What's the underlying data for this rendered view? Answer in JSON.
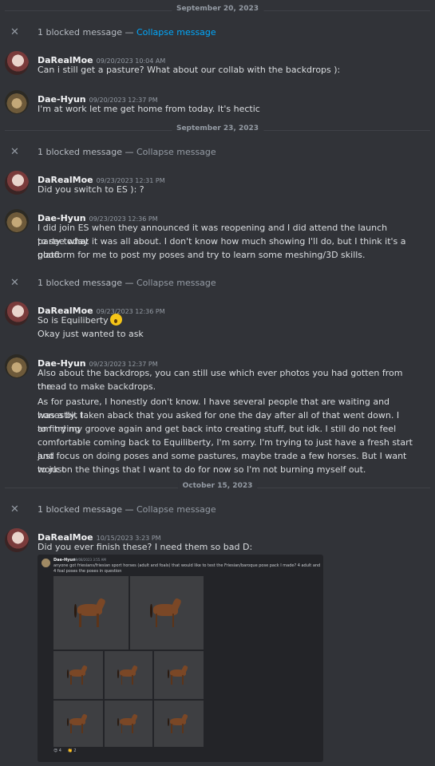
{
  "dividers": [
    "September 20, 2023",
    "September 23, 2023",
    "October 15, 2023"
  ],
  "blocked": {
    "icon": "close-icon",
    "text": "1 blocked message",
    "dash": " — ",
    "link": "Collapse message"
  },
  "messages": [
    {
      "author": "DaRealMoe",
      "time": "09/20/2023 10:04 AM",
      "lines": [
        "Can i still get a pasture? What about our collab with the backdrops ):"
      ]
    },
    {
      "author": "Dae-Hyun",
      "time": "09/20/2023 12:37 PM",
      "lines": [
        "I'm at work let me get home from today. It's hectic"
      ]
    },
    {
      "author": "DaRealMoe",
      "time": "09/23/2023 12:31 PM",
      "lines": [
        "Did you switch to ES ): ?"
      ]
    },
    {
      "author": "Dae-Hyun",
      "time": "09/23/2023 12:36 PM",
      "lines": [
        "I did join ES when they announced it was reopening and I did attend the launch party today",
        "to see what it was all about. I don't know how much showing I'll do, but I think it's a good",
        "platform for me to post my poses and try to learn some meshing/3D skills."
      ]
    },
    {
      "author": "DaRealMoe",
      "time": "09/23/2023 12:36 PM",
      "lines": [
        "So is Equiliberty",
        "Okay just wanted to ask"
      ],
      "emoji": "astonished-emoji"
    },
    {
      "author": "Dae-Hyun",
      "time": "09/23/2023 12:37 PM",
      "lines": [
        "Also about the backdrops, you can still use which ever photos you had gotten from the",
        "thread to make backdrops.",
        "As for pasture, I honestly don't know. I have several people that are waiting and honestly, I",
        "was a bit taken aback that you asked for one the day after all of that went down. I am trying",
        "to find my groove again and get back into creating stuff, but idk. I still do not feel",
        "comfortable coming back to Equiliberty, I'm sorry. I'm trying to just have a fresh start and",
        "just focus on doing poses and some pastures, maybe trade a few horses. But I want to just",
        "work on the things that I want to do for now so I'm not burning myself out."
      ]
    },
    {
      "author": "DaRealMoe",
      "time": "10/15/2023 3:23 PM",
      "lines": [
        "Did you ever finish these? I need them so bad D:"
      ]
    }
  ],
  "embed": {
    "author": "Dae-Hyun",
    "time": "09/08/2023 3:55 AM",
    "text": "anyone got friesians/friesian sport horses (adult and foals) that would like to test the Friesian/baroque pose pack I made? 4 adult and 4 foal poses the poses in question",
    "reactions": [
      "😍 4",
      "👏 2"
    ]
  }
}
